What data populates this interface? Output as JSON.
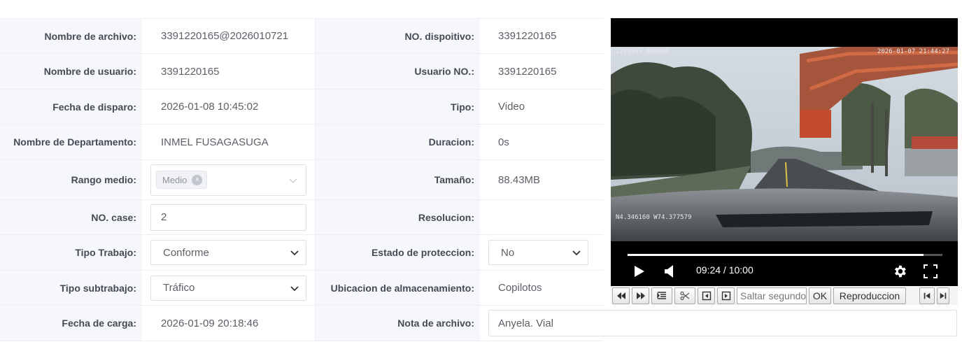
{
  "fields": {
    "nombre_archivo": {
      "label": "Nombre de archivo:",
      "value": "3391220165@2026010721"
    },
    "no_dispositivo": {
      "label": "NO. dispoitivo:",
      "value": "3391220165"
    },
    "nombre_usuario": {
      "label": "Nombre de usuario:",
      "value": "3391220165"
    },
    "usuario_no": {
      "label": "Usuario NO.:",
      "value": "3391220165"
    },
    "fecha_disparo": {
      "label": "Fecha de disparo:",
      "value": "2026-01-08 10:45:02"
    },
    "tipo": {
      "label": "Tipo:",
      "value": "Video"
    },
    "departamento": {
      "label": "Nombre de Departamento:",
      "value": "INMEL FUSAGASUGA"
    },
    "duracion": {
      "label": "Duracion:",
      "value": "0s"
    },
    "rango_medio": {
      "label": "Rango medio:",
      "tag": "Medio"
    },
    "tamano": {
      "label": "Tamaño:",
      "value": "88.43MB"
    },
    "no_case": {
      "label": "NO. case:",
      "value": "2"
    },
    "resolucion": {
      "label": "Resolucion:",
      "value": ""
    },
    "tipo_trabajo": {
      "label": "Tipo Trabajo:",
      "value": "Conforme"
    },
    "estado_proteccion": {
      "label": "Estado de proteccion:",
      "value": "No"
    },
    "tipo_subtrabajo": {
      "label": "Tipo subtrabajo:",
      "value": "Tráfico"
    },
    "ubicacion": {
      "label": "Ubicacion de almacenamiento:",
      "value": "Copilotos"
    },
    "fecha_carga": {
      "label": "Fecha de carga:",
      "value": "2026-01-09 20:18:46"
    },
    "nota_archivo": {
      "label": "Nota de archivo:",
      "value": "Anyela. Vial"
    }
  },
  "player": {
    "osd_channel": "1220165_000000",
    "osd_datetime": "2026-01-07 21:44:27",
    "osd_gps": "N4.346160  W74.377579",
    "time_display": "09:24 / 10:00",
    "progress_fraction": 0.94
  },
  "toolbar": {
    "skip_placeholder": "Saltar segundos",
    "ok_label": "OK",
    "playback_label": "Reproduccion"
  }
}
